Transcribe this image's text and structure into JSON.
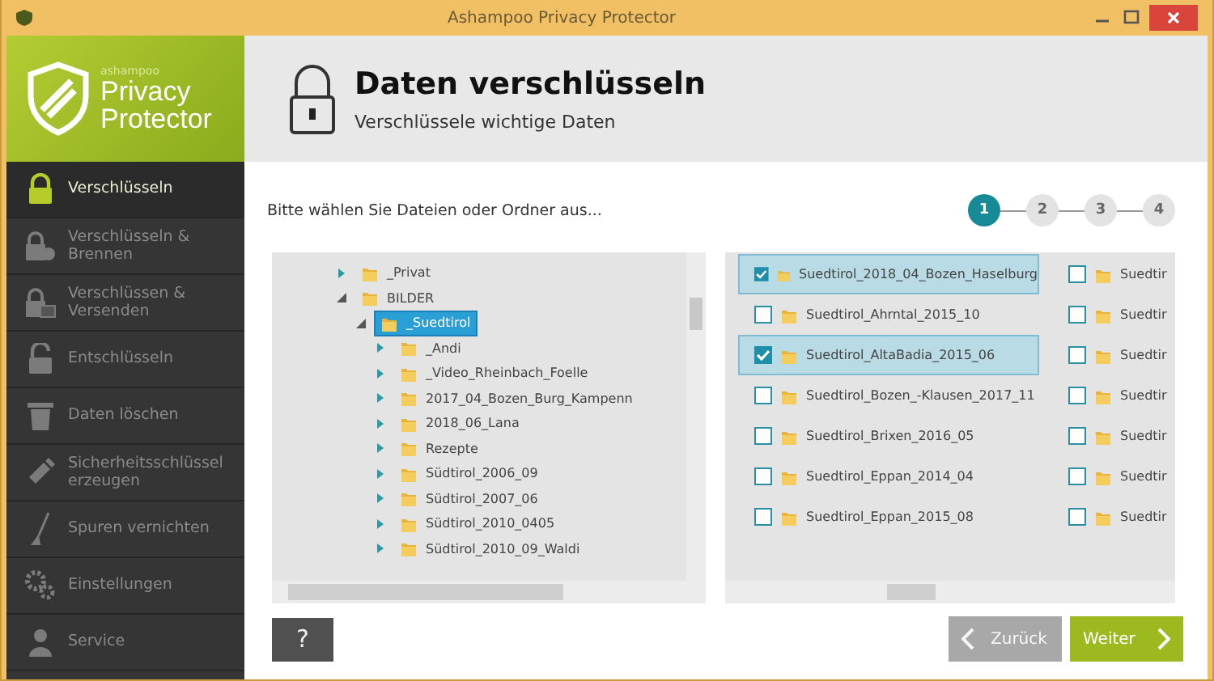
{
  "window": {
    "title": "Ashampoo Privacy Protector"
  },
  "logo": {
    "brand": "ashampoo",
    "line1": "Privacy",
    "line2": "Protector"
  },
  "sidebar": {
    "items": [
      {
        "label": "Verschlüsseln",
        "selected": true
      },
      {
        "label": "Verschlüsseln & Brennen",
        "selected": false
      },
      {
        "label": "Verschlüssen & Versenden",
        "selected": false
      },
      {
        "label": "Entschlüsseln",
        "selected": false
      },
      {
        "label": "Daten löschen",
        "selected": false
      },
      {
        "label": "Sicherheitsschlüssel erzeugen",
        "selected": false
      },
      {
        "label": "Spuren vernichten",
        "selected": false
      },
      {
        "label": "Einstellungen",
        "selected": false
      },
      {
        "label": "Service",
        "selected": false
      }
    ]
  },
  "header": {
    "title": "Daten verschlüsseln",
    "subtitle": "Verschlüssele wichtige Daten"
  },
  "prompt": "Bitte wählen Sie Dateien oder Ordner aus...",
  "steps": [
    {
      "label": "1",
      "selected": true
    },
    {
      "label": "2",
      "selected": false
    },
    {
      "label": "3",
      "selected": false
    },
    {
      "label": "4",
      "selected": false
    }
  ],
  "tree": {
    "items": [
      {
        "label": "_Privat",
        "expanded": false,
        "selected": false
      },
      {
        "label": "BILDER",
        "expanded": true,
        "selected": false,
        "children": [
          {
            "label": "_Suedtirol",
            "expanded": true,
            "selected": true,
            "children": [
              {
                "label": "_Andi",
                "expanded": false,
                "selected": false
              },
              {
                "label": "_Video_Rheinbach_Foelle",
                "expanded": false,
                "selected": false
              },
              {
                "label": "2017_04_Bozen_Burg_Kampenn",
                "expanded": false,
                "selected": false
              },
              {
                "label": "2018_06_Lana",
                "expanded": false,
                "selected": false
              },
              {
                "label": "Rezepte",
                "expanded": false,
                "selected": false
              },
              {
                "label": "Südtirol_2006_09",
                "expanded": false,
                "selected": false
              },
              {
                "label": "Südtirol_2007_06",
                "expanded": false,
                "selected": false
              },
              {
                "label": "Südtirol_2010_0405",
                "expanded": false,
                "selected": false
              },
              {
                "label": "Südtirol_2010_09_Waldi",
                "expanded": false,
                "selected": false
              }
            ]
          }
        ]
      }
    ]
  },
  "files": {
    "columns": [
      {
        "rows": [
          {
            "name": "Suedtirol_2018_04_Bozen_Haselburg",
            "checked": true,
            "selected": true
          },
          {
            "name": "Suedtirol_Ahrntal_2015_10",
            "checked": false,
            "selected": false
          },
          {
            "name": "Suedtirol_AltaBadia_2015_06",
            "checked": true,
            "selected": true
          },
          {
            "name": "Suedtirol_Bozen_-Klausen_2017_11",
            "checked": false,
            "selected": false
          },
          {
            "name": "Suedtirol_Brixen_2016_05",
            "checked": false,
            "selected": false
          },
          {
            "name": "Suedtirol_Eppan_2014_04",
            "checked": false,
            "selected": false
          },
          {
            "name": "Suedtirol_Eppan_2015_08",
            "checked": false,
            "selected": false
          }
        ]
      },
      {
        "rows": [
          {
            "name": "Suedtir",
            "checked": false,
            "selected": false
          },
          {
            "name": "Suedtir",
            "checked": false,
            "selected": false
          },
          {
            "name": "Suedtir",
            "checked": false,
            "selected": false
          },
          {
            "name": "Suedtir",
            "checked": false,
            "selected": false
          },
          {
            "name": "Suedtir",
            "checked": false,
            "selected": false
          },
          {
            "name": "Suedtir",
            "checked": false,
            "selected": false
          },
          {
            "name": "Suedtir",
            "checked": false,
            "selected": false
          }
        ]
      }
    ]
  },
  "buttons": {
    "help": {
      "label": "?"
    },
    "back": {
      "label": "Zurück",
      "disabled": true
    },
    "next": {
      "label": "Weiter",
      "disabled": false
    }
  }
}
